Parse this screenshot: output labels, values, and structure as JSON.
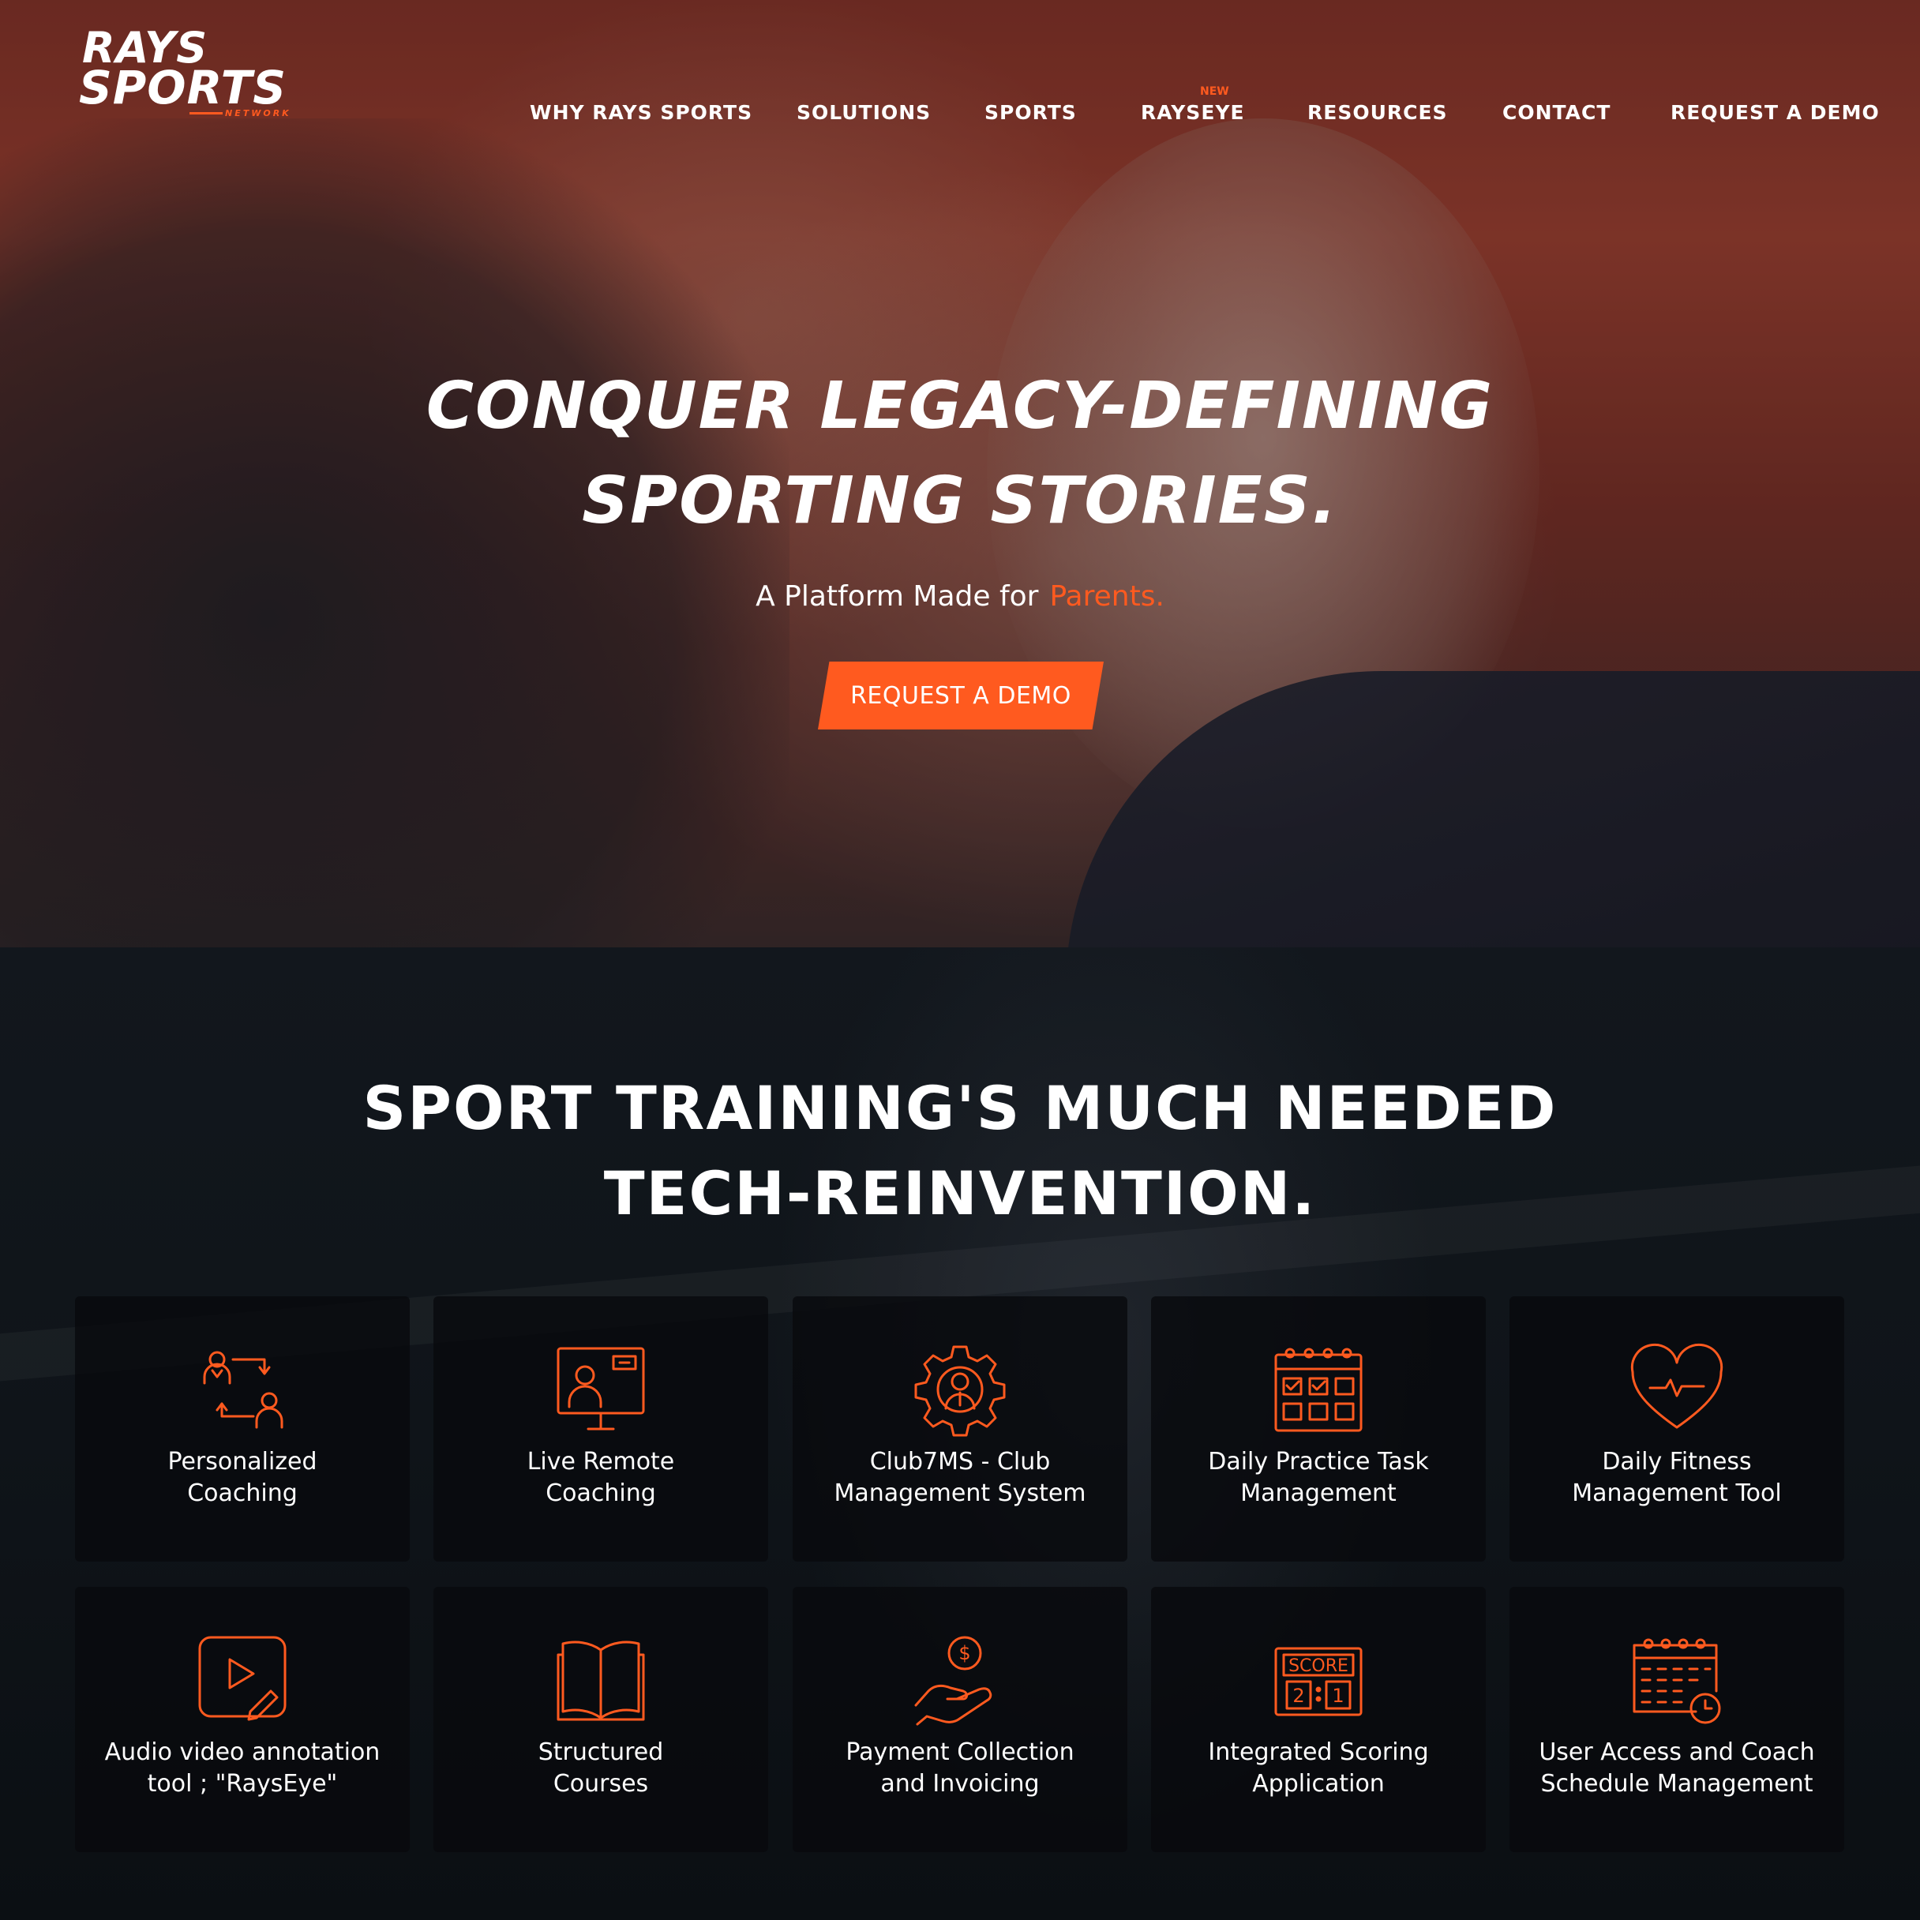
{
  "brand": {
    "logo_line1": "RAYS",
    "logo_line2": "SPORTS",
    "logo_sub": "NETWORK",
    "accent_color": "#ff5a1f"
  },
  "nav": {
    "items": [
      {
        "label": "WHY RAYS SPORTS"
      },
      {
        "label": "SOLUTIONS"
      },
      {
        "label": "SPORTS"
      },
      {
        "label": "RAYSEYE",
        "badge": "NEW"
      },
      {
        "label": "RESOURCES"
      },
      {
        "label": "CONTACT"
      },
      {
        "label": "REQUEST A DEMO"
      }
    ]
  },
  "hero": {
    "title_line1": "CONQUER LEGACY-DEFINING",
    "title_line2": "SPORTING STORIES.",
    "subtitle": "A Platform Made for",
    "subtitle_accent": "Parents.",
    "cta": "REQUEST A DEMO"
  },
  "features": {
    "title_line1": "SPORT TRAINING'S MUCH NEEDED",
    "title_line2": "TECH-REINVENTION.",
    "cards": [
      {
        "icon": "coach-swap-icon",
        "label_line1": "Personalized",
        "label_line2": "Coaching"
      },
      {
        "icon": "video-call-icon",
        "label_line1": "Live Remote",
        "label_line2": "Coaching"
      },
      {
        "icon": "gear-person-icon",
        "label_line1": "Club7MS - Club",
        "label_line2": "Management System"
      },
      {
        "icon": "calendar-check-icon",
        "label_line1": "Daily Practice Task",
        "label_line2": "Management"
      },
      {
        "icon": "heart-pulse-icon",
        "label_line1": "Daily Fitness",
        "label_line2": "Management Tool"
      },
      {
        "icon": "video-annotate-icon",
        "label_line1": "Audio video annotation",
        "label_line2": "tool ; \"RaysEye\""
      },
      {
        "icon": "open-book-icon",
        "label_line1": "Structured",
        "label_line2": "Courses"
      },
      {
        "icon": "hand-coin-icon",
        "label_line1": "Payment Collection",
        "label_line2": "and Invoicing"
      },
      {
        "icon": "scoreboard-icon",
        "label_line1": "Integrated Scoring",
        "label_line2": "Application"
      },
      {
        "icon": "calendar-clock-icon",
        "label_line1": "User Access and Coach",
        "label_line2": "Schedule Management"
      }
    ],
    "scoreboard_text": "SCORE",
    "scoreboard_left": "2",
    "scoreboard_right": "1",
    "coin_symbol": "$"
  }
}
